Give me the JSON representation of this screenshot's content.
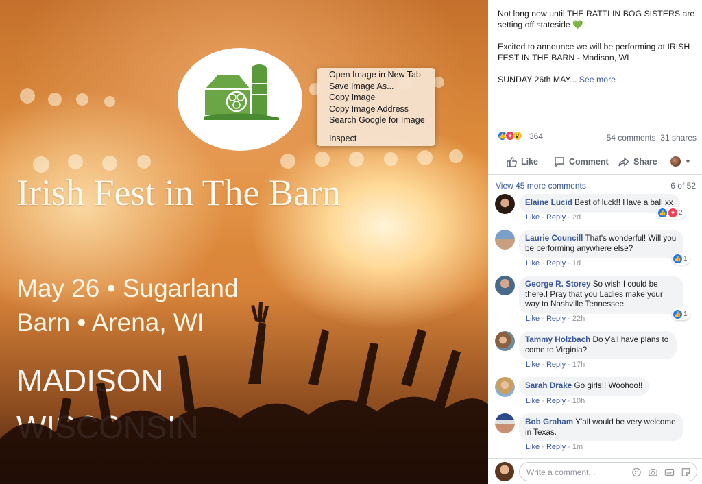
{
  "photo": {
    "title": "Irish Fest in The Barn",
    "date_line1": "May 26  •  Sugarland",
    "date_line2": "Barn  •  Arena, WI",
    "city": "MADISON",
    "state": "WISCONSIN"
  },
  "context_menu": {
    "items": [
      "Open Image in New Tab",
      "Save Image As...",
      "Copy Image",
      "Copy Image Address",
      "Search Google for Image"
    ],
    "inspect": "Inspect"
  },
  "post": {
    "p1": "Not long now until THE RATTLIN BOG SISTERS are setting off stateside 💚",
    "p2": "Excited to announce we will be performing at IRISH FEST IN THE BARN - Madison, WI",
    "p3": "SUNDAY 26th MAY...",
    "see_more": "See more",
    "reaction_count": "364",
    "comment_count": "54 comments",
    "share_count": "31 shares"
  },
  "actions": {
    "like": "Like",
    "comment": "Comment",
    "share": "Share"
  },
  "comments_header": {
    "view_more": "View 45 more comments",
    "page": "6 of 52"
  },
  "comments": [
    {
      "name": "Elaine Lucid",
      "text": "Best of luck!! Have a ball xx",
      "time": "2d",
      "reactions": "2"
    },
    {
      "name": "Laurie Councill",
      "text": "That's wonderful! Will you be performing anywhere else?",
      "time": "1d",
      "reactions": "1"
    },
    {
      "name": "George R. Storey",
      "text": "So wish I could be there.I Pray that you Ladies make your way to Nashville Tennessee",
      "time": "22h",
      "reactions": "1"
    },
    {
      "name": "Tammy Holzbach",
      "text": "Do y'all have plans to come to Virginia?",
      "time": "17h",
      "reactions": ""
    },
    {
      "name": "Sarah Drake",
      "text": "Go girls!! Woohoo!!",
      "time": "10h",
      "reactions": ""
    },
    {
      "name": "Bob Graham",
      "text": "Y'all would be very welcome in Texas.",
      "time": "1m",
      "reactions": ""
    }
  ],
  "comment_meta": {
    "like": "Like",
    "reply": "Reply",
    "sep": "·"
  },
  "composer": {
    "placeholder": "Write a comment..."
  },
  "colors": {
    "link": "#385898",
    "like_blue": "#2078f4",
    "love_red": "#f33e58",
    "menu_bg": "#f6e2ce"
  },
  "icons": [
    "like-icon",
    "comment-icon",
    "share-icon",
    "emoji-icon",
    "camera-icon",
    "gif-icon",
    "sticker-icon",
    "barn-logo-icon"
  ]
}
